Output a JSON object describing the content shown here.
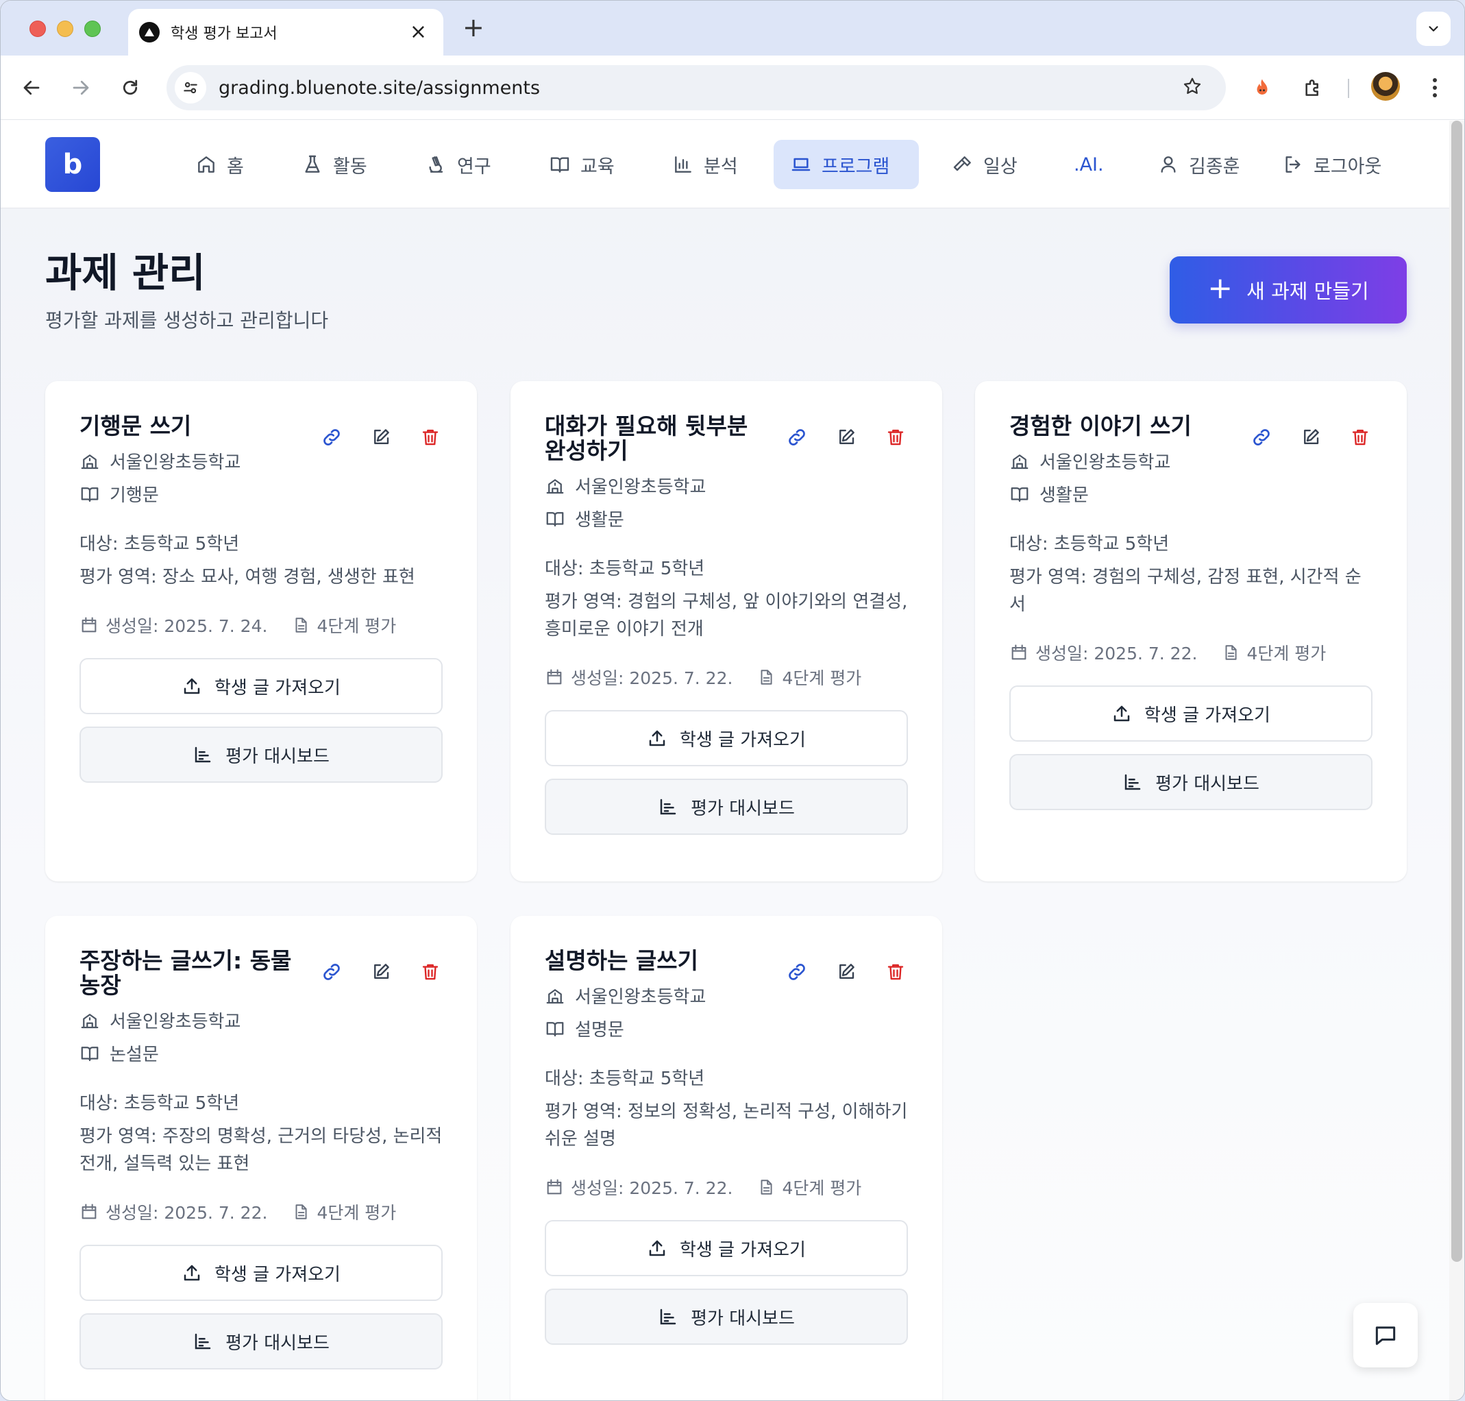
{
  "browser": {
    "tab_title": "학생 평가 보고서",
    "url_host": "grading.bluenote.site",
    "url_path": "/assignments"
  },
  "app": {
    "logo_text": "b",
    "nav": [
      {
        "label": "홈",
        "icon": "home-icon"
      },
      {
        "label": "활동",
        "icon": "flask-icon"
      },
      {
        "label": "연구",
        "icon": "microscope-icon"
      },
      {
        "label": "교육",
        "icon": "book-icon"
      },
      {
        "label": "분석",
        "icon": "bar-chart-icon"
      },
      {
        "label": "프로그램",
        "icon": "laptop-icon",
        "active": true
      },
      {
        "label": "일상",
        "icon": "hammer-icon"
      },
      {
        "label": ".AI.",
        "icon": ""
      },
      {
        "label": "김종훈",
        "icon": "user-icon"
      },
      {
        "label": "로그아웃",
        "icon": "logout-icon"
      }
    ]
  },
  "header": {
    "title": "과제 관리",
    "subtitle": "평가할 과제를 생성하고 관리합니다",
    "new_button": "새 과제 만들기"
  },
  "labels": {
    "import": "학생 글 가져오기",
    "dashboard": "평가 대시보드"
  },
  "assignments": [
    {
      "title": "기행문 쓰기",
      "school": "서울인왕초등학교",
      "genre": "기행문",
      "target": "대상: 초등학교 5학년",
      "areas": "평가 영역: 장소 묘사, 여행 경험, 생생한 표현",
      "created": "생성일: 2025. 7. 24.",
      "levels": "4단계 평가"
    },
    {
      "title": "대화가 필요해 뒷부분 완성하기",
      "school": "서울인왕초등학교",
      "genre": "생활문",
      "target": "대상: 초등학교 5학년",
      "areas": "평가 영역: 경험의 구체성, 앞 이야기와의 연결성, 흥미로운 이야기 전개",
      "created": "생성일: 2025. 7. 22.",
      "levels": "4단계 평가"
    },
    {
      "title": "경험한 이야기 쓰기",
      "school": "서울인왕초등학교",
      "genre": "생활문",
      "target": "대상: 초등학교 5학년",
      "areas": "평가 영역: 경험의 구체성, 감정 표현, 시간적 순서",
      "created": "생성일: 2025. 7. 22.",
      "levels": "4단계 평가"
    },
    {
      "title": "주장하는 글쓰기: 동물 농장",
      "school": "서울인왕초등학교",
      "genre": "논설문",
      "target": "대상: 초등학교 5학년",
      "areas": "평가 영역: 주장의 명확성, 근거의 타당성, 논리적 전개, 설득력 있는 표현",
      "created": "생성일: 2025. 7. 22.",
      "levels": "4단계 평가"
    },
    {
      "title": "설명하는 글쓰기",
      "school": "서울인왕초등학교",
      "genre": "설명문",
      "target": "대상: 초등학교 5학년",
      "areas": "평가 영역: 정보의 정확성, 논리적 구성, 이해하기 쉬운 설명",
      "created": "생성일: 2025. 7. 22.",
      "levels": "4단계 평가"
    }
  ],
  "colors": {
    "accent": "#2b55d0",
    "delete": "#dc2626",
    "gradient_start": "#2f5de6",
    "gradient_end": "#7e3ee6"
  }
}
